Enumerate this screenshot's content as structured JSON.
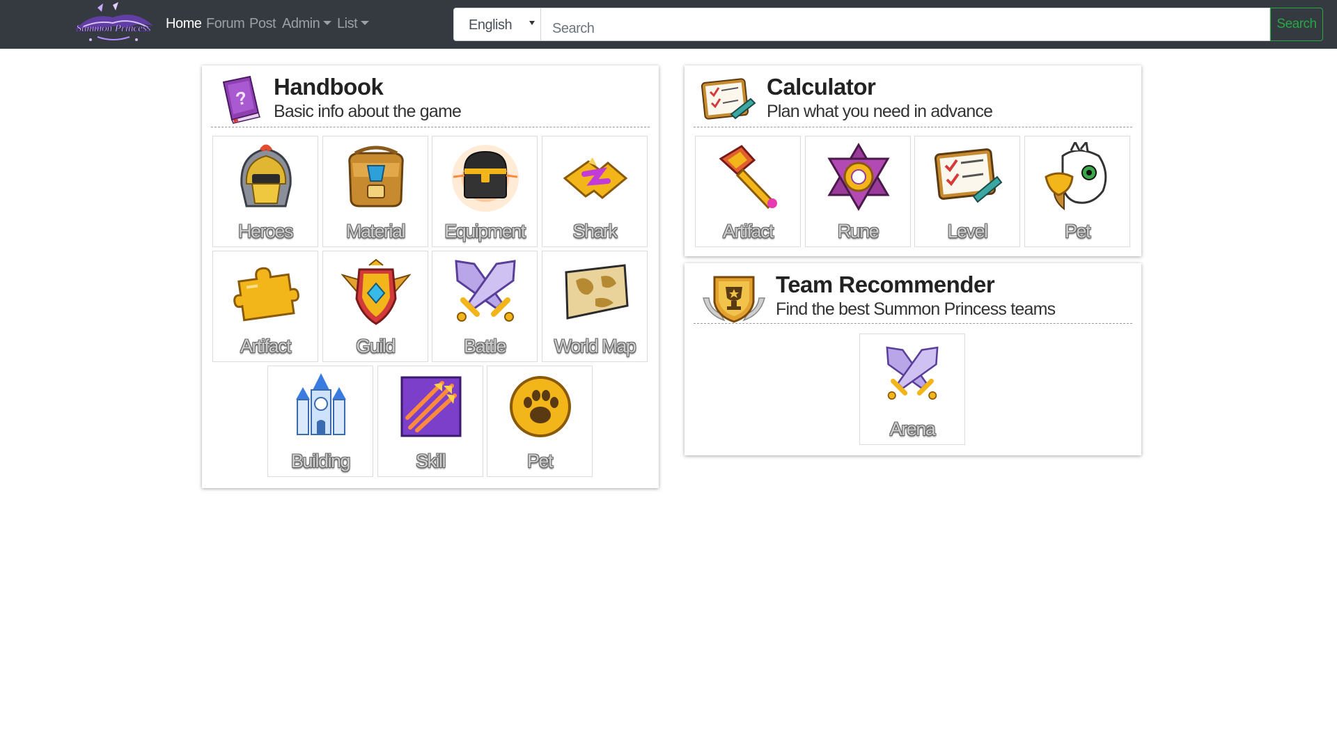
{
  "nav": {
    "logo_alt": "Summon Princess",
    "links": [
      {
        "label": "Home",
        "active": true
      },
      {
        "label": "Forum"
      },
      {
        "label": "Post"
      },
      {
        "label": "Admin",
        "dropdown": true
      },
      {
        "label": "List",
        "dropdown": true
      }
    ],
    "language": "English",
    "search_placeholder": "Search",
    "search_button": "Search"
  },
  "handbook": {
    "icon": "purple-book-icon",
    "title": "Handbook",
    "subtitle": "Basic info about the game",
    "tiles": [
      {
        "label": "Heroes",
        "icon": "helmet-icon"
      },
      {
        "label": "Material",
        "icon": "backpack-icon"
      },
      {
        "label": "Equipment",
        "icon": "treasure-chest-icon"
      },
      {
        "label": "Shark",
        "icon": "puzzle-shard-icon"
      },
      {
        "label": "Artifact",
        "icon": "puzzle-piece-icon"
      },
      {
        "label": "Guild",
        "icon": "guild-crest-icon"
      },
      {
        "label": "Battle",
        "icon": "crossed-swords-icon"
      },
      {
        "label": "World Map",
        "icon": "map-icon"
      },
      {
        "label": "Building",
        "icon": "castle-icon"
      },
      {
        "label": "Skill",
        "icon": "skill-arrows-icon"
      },
      {
        "label": "Pet",
        "icon": "paw-icon"
      }
    ]
  },
  "calculator": {
    "icon": "checklist-icon",
    "title": "Calculator",
    "subtitle": "Plan what you need in advance",
    "tiles": [
      {
        "label": "Artifact",
        "icon": "hammer-icon"
      },
      {
        "label": "Rune",
        "icon": "hexagram-rune-icon"
      },
      {
        "label": "Level",
        "icon": "checklist-icon"
      },
      {
        "label": "Pet",
        "icon": "eagle-icon"
      }
    ]
  },
  "team": {
    "icon": "trophy-badge-icon",
    "title": "Team Recommender",
    "subtitle": "Find the best Summon Princess teams",
    "tiles": [
      {
        "label": "Arena",
        "icon": "crossed-swords-icon"
      }
    ]
  }
}
